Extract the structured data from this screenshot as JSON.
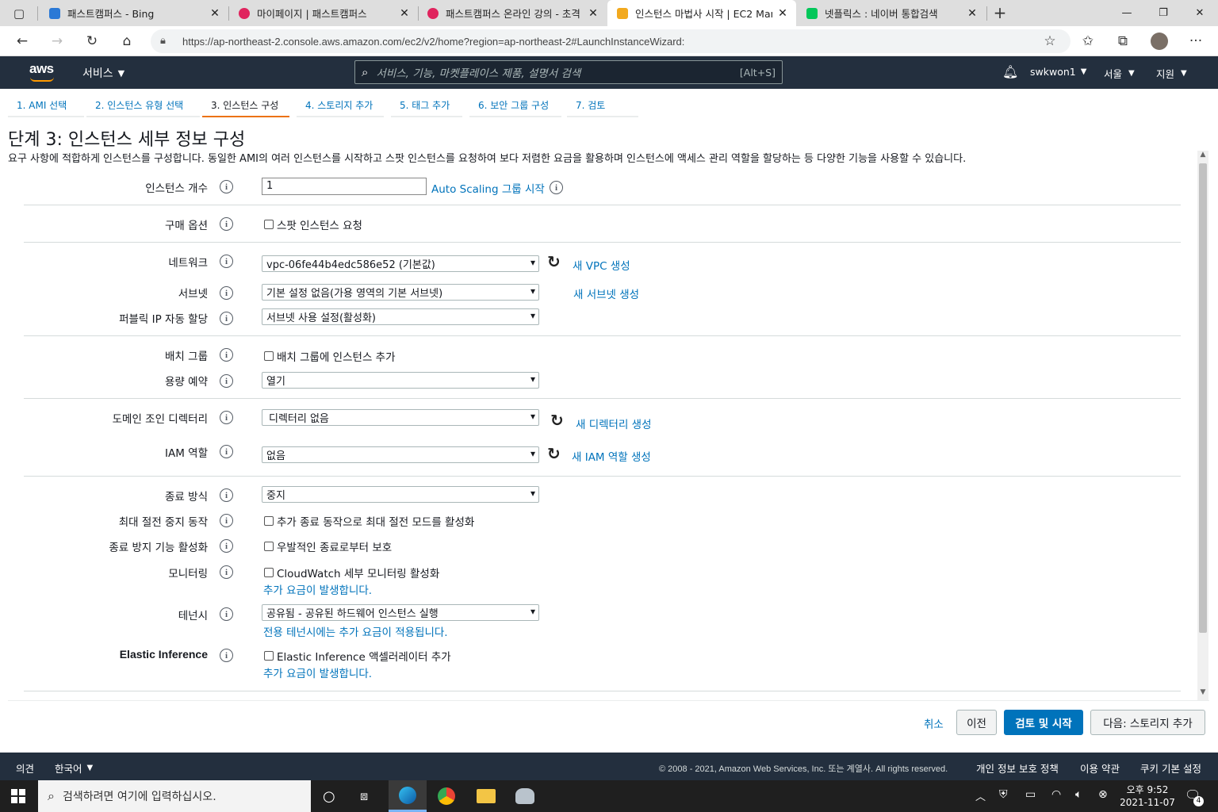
{
  "browser": {
    "tabs": [
      {
        "title": "패스트캠퍼스 - Bing",
        "color": "#2b79d6"
      },
      {
        "title": "마이페이지 | 패스트캠퍼스",
        "color": "#e0245e"
      },
      {
        "title": "패스트캠퍼스 온라인 강의 - 초격",
        "color": "#e0245e"
      },
      {
        "title": "인스턴스 마법사 시작 | EC2 Man",
        "color": "#f2a91e"
      },
      {
        "title": "넷플릭스 : 네이버 통합검색",
        "color": "#03c75a"
      }
    ],
    "url": "https://ap-northeast-2.console.aws.amazon.com/ec2/v2/home?region=ap-northeast-2#LaunchInstanceWizard:"
  },
  "aws_header": {
    "logo": "aws",
    "services": "서비스",
    "search_placeholder": "서비스, 기능, 마켓플레이스 제품, 설명서 검색",
    "search_shortcut": "[Alt+S]",
    "user": "swkwon1",
    "region": "서울",
    "support": "지원"
  },
  "steps": [
    "1. AMI 선택",
    "2. 인스턴스 유형 선택",
    "3. 인스턴스 구성",
    "4. 스토리지 추가",
    "5. 태그 추가",
    "6. 보안 그룹 구성",
    "7. 검토"
  ],
  "page": {
    "title": "단계 3: 인스턴스 세부 정보 구성",
    "description": "요구 사항에 적합하게 인스턴스를 구성합니다. 동일한 AMI의 여러 인스턴스를 시작하고 스팟 인스턴스를 요청하여 보다 저렴한 요금을 활용하며 인스턴스에 액세스 관리 역할을 할당하는 등 다양한 기능을 사용할 수 있습니다."
  },
  "form": {
    "instance_count_label": "인스턴스 개수",
    "instance_count_value": "1",
    "auto_scaling_link": "Auto Scaling 그룹 시작",
    "purchase_label": "구매 옵션",
    "spot_checkbox": "스팟 인스턴스 요청",
    "network_label": "네트워크",
    "network_value": "vpc-06fe44b4edc586e52 (기본값)",
    "new_vpc_link": "새 VPC 생성",
    "subnet_label": "서브넷",
    "subnet_value": "기본 설정 없음(가용 영역의 기본 서브넷)",
    "new_subnet_link": "새 서브넷 생성",
    "public_ip_label": "퍼블릭 IP 자동 할당",
    "public_ip_value": "서브넷 사용 설정(활성화)",
    "placement_label": "배치 그룹",
    "placement_checkbox": "배치 그룹에 인스턴스 추가",
    "capacity_label": "용량 예약",
    "capacity_value": "열기",
    "domain_label": "도메인 조인 디렉터리",
    "domain_value": "디렉터리 없음",
    "new_directory_link": "새 디렉터리 생성",
    "iam_label": "IAM 역할",
    "iam_value": "없음",
    "new_iam_link": "새 IAM 역할 생성",
    "shutdown_label": "종료 방식",
    "shutdown_value": "중지",
    "hibernate_label": "최대 절전 중지 동작",
    "hibernate_checkbox": "추가 종료 동작으로 최대 절전 모드를 활성화",
    "termination_label": "종료 방지 기능 활성화",
    "termination_checkbox": "우발적인 종료로부터 보호",
    "monitoring_label": "모니터링",
    "monitoring_checkbox": "CloudWatch 세부 모니터링 활성화",
    "monitoring_note": "추가 요금이 발생합니다.",
    "tenancy_label": "테넌시",
    "tenancy_value": "공유됨 - 공유된 하드웨어 인스턴스 실행",
    "tenancy_note": "전용 테넌시에는 추가 요금이 적용됩니다.",
    "elastic_label": "Elastic Inference",
    "elastic_checkbox": "Elastic Inference 액셀러레이터 추가",
    "elastic_note": "추가 요금이 발생합니다."
  },
  "buttons": {
    "cancel": "취소",
    "prev": "이전",
    "review": "검토 및 시작",
    "next": "다음: 스토리지 추가"
  },
  "footer": {
    "feedback": "의견",
    "language": "한국어",
    "copyright": "© 2008 - 2021, Amazon Web Services, Inc. 또는 계열사. All rights reserved.",
    "privacy": "개인 정보 보호 정책",
    "terms": "이용 약관",
    "cookies": "쿠키 기본 설정"
  },
  "taskbar": {
    "search_placeholder": "검색하려면 여기에 입력하십시오.",
    "time": "오후 9:52",
    "date": "2021-11-07",
    "notification_count": "4"
  }
}
